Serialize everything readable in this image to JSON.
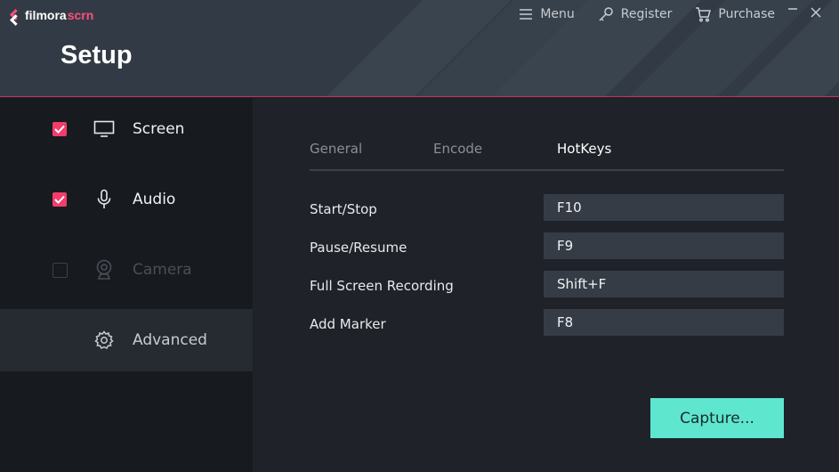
{
  "app": {
    "logo_word1": "filmora",
    "logo_word2": "scrn",
    "page_title": "Setup"
  },
  "topnav": {
    "menu_label": "Menu",
    "register_label": "Register",
    "purchase_label": "Purchase",
    "icons": [
      "hamburger-icon",
      "key-icon",
      "cart-icon",
      "minimize-icon",
      "close-icon"
    ]
  },
  "sidebar": {
    "items": [
      {
        "label": "Screen",
        "checked": true,
        "icon": "monitor-icon"
      },
      {
        "label": "Audio",
        "checked": true,
        "icon": "microphone-icon"
      },
      {
        "label": "Camera",
        "checked": false,
        "disabled": true,
        "icon": "webcam-icon"
      },
      {
        "label": "Advanced",
        "active": true,
        "icon": "gear-icon"
      }
    ]
  },
  "tabs": [
    {
      "label": "General"
    },
    {
      "label": "Encode"
    },
    {
      "label": "HotKeys",
      "active": true
    }
  ],
  "hotkeys": [
    {
      "label": "Start/Stop",
      "value": "F10"
    },
    {
      "label": "Pause/Resume",
      "value": "F9"
    },
    {
      "label": "Full Screen Recording",
      "value": "Shift+F"
    },
    {
      "label": "Add Marker",
      "value": "F8"
    }
  ],
  "capture_label": "Capture...",
  "colors": {
    "accent": "#f23d6c",
    "capture_button": "#5ee6cf",
    "header_bg": "#323b45",
    "sidebar_bg": "#171a1f",
    "main_bg": "#1f2228"
  }
}
